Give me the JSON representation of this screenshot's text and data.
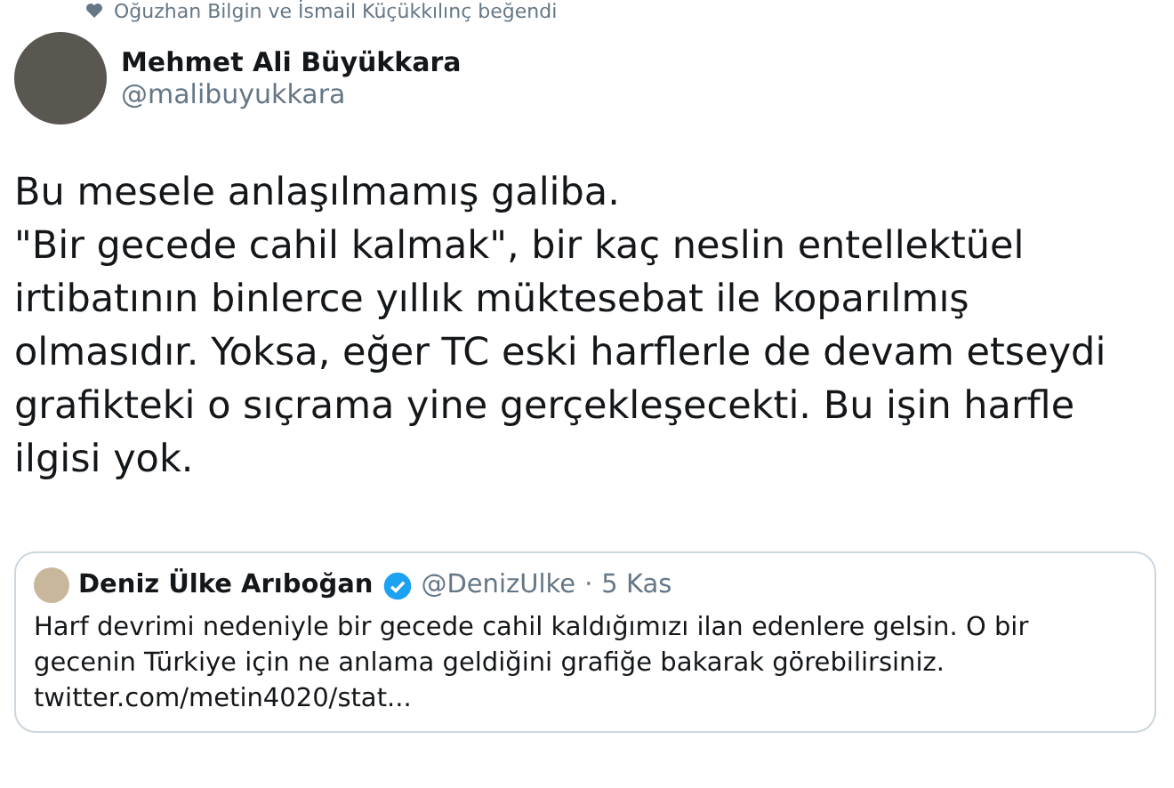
{
  "social_context": "Oğuzhan Bilgin ve İsmail Küçükkılınç beğendi",
  "author": {
    "name": "Mehmet Ali Büyükkara",
    "handle": "@malibuyukkara"
  },
  "tweet_lines": [
    "Bu mesele anlaşılmamış galiba.",
    "\"Bir gecede cahil kalmak\", bir kaç neslin entellektüel irtibatının binlerce yıllık müktesebat ile koparılmış olmasıdır. Yoksa, eğer TC eski harflerle de devam etseydi grafikteki o sıçrama yine gerçekleşecekti. Bu işin harfle ilgisi yok."
  ],
  "quoted": {
    "name": "Deniz Ülke Arıboğan",
    "verified": true,
    "handle": "@DenizUlke",
    "separator": "·",
    "date": "5 Kas",
    "text": "Harf devrimi nedeniyle bir gecede cahil kaldığımızı ilan edenlere gelsin. O bir gecenin Türkiye için ne anlama geldiğini grafiğe bakarak görebilirsiniz.",
    "link": "twitter.com/metin4020/stat..."
  }
}
